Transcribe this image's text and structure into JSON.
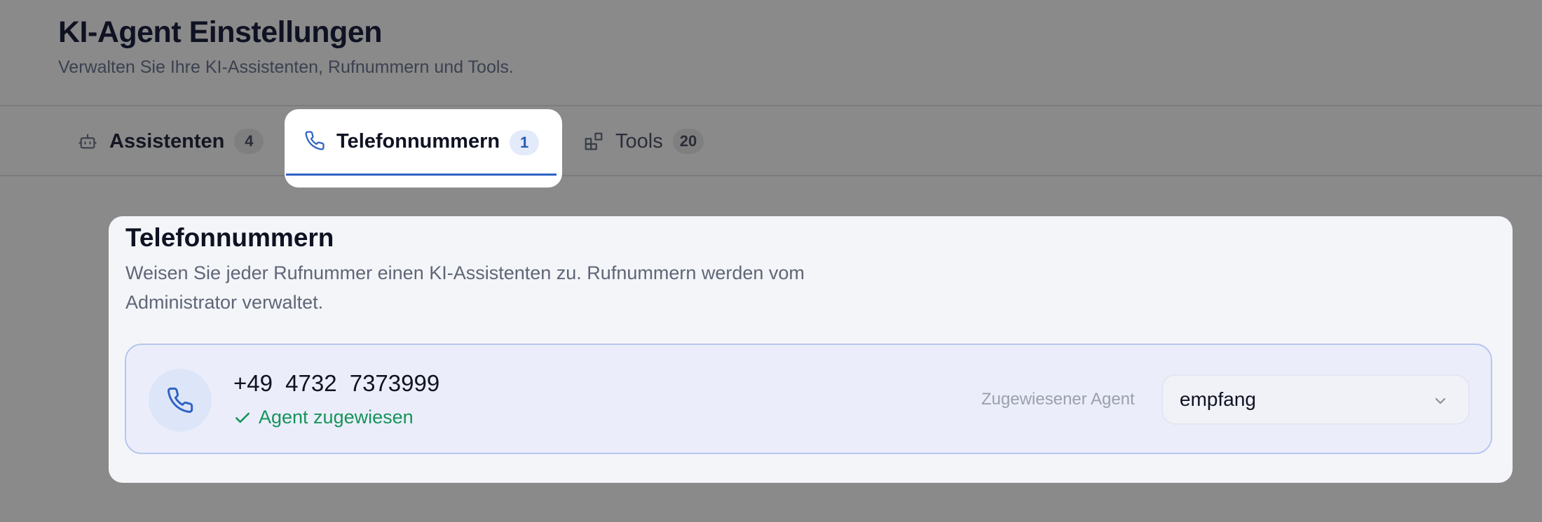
{
  "header": {
    "title": "KI-Agent Einstellungen",
    "subtitle": "Verwalten Sie Ihre KI-Assistenten, Rufnummern und Tools."
  },
  "tabs": [
    {
      "label": "Assistenten",
      "count": "4",
      "icon": "robot-icon",
      "active": false
    },
    {
      "label": "Telefonnummern",
      "count": "1",
      "icon": "phone-icon",
      "active": true
    },
    {
      "label": "Tools",
      "count": "20",
      "icon": "apps-icon",
      "active": false
    }
  ],
  "panel": {
    "title": "Telefonnummern",
    "description": "Weisen Sie jeder Rufnummer einen KI-Assistenten zu. Rufnummern werden vom Administrator verwaltet."
  },
  "phone_numbers": [
    {
      "number": "+49 4732 7373999",
      "status": "Agent zugewiesen",
      "agent_label": "Zugewiesener Agent",
      "agent_selected": "empfang"
    }
  ],
  "colors": {
    "accent": "#2f63c4",
    "success": "#17935a",
    "overlay": "#8a8a8a"
  }
}
